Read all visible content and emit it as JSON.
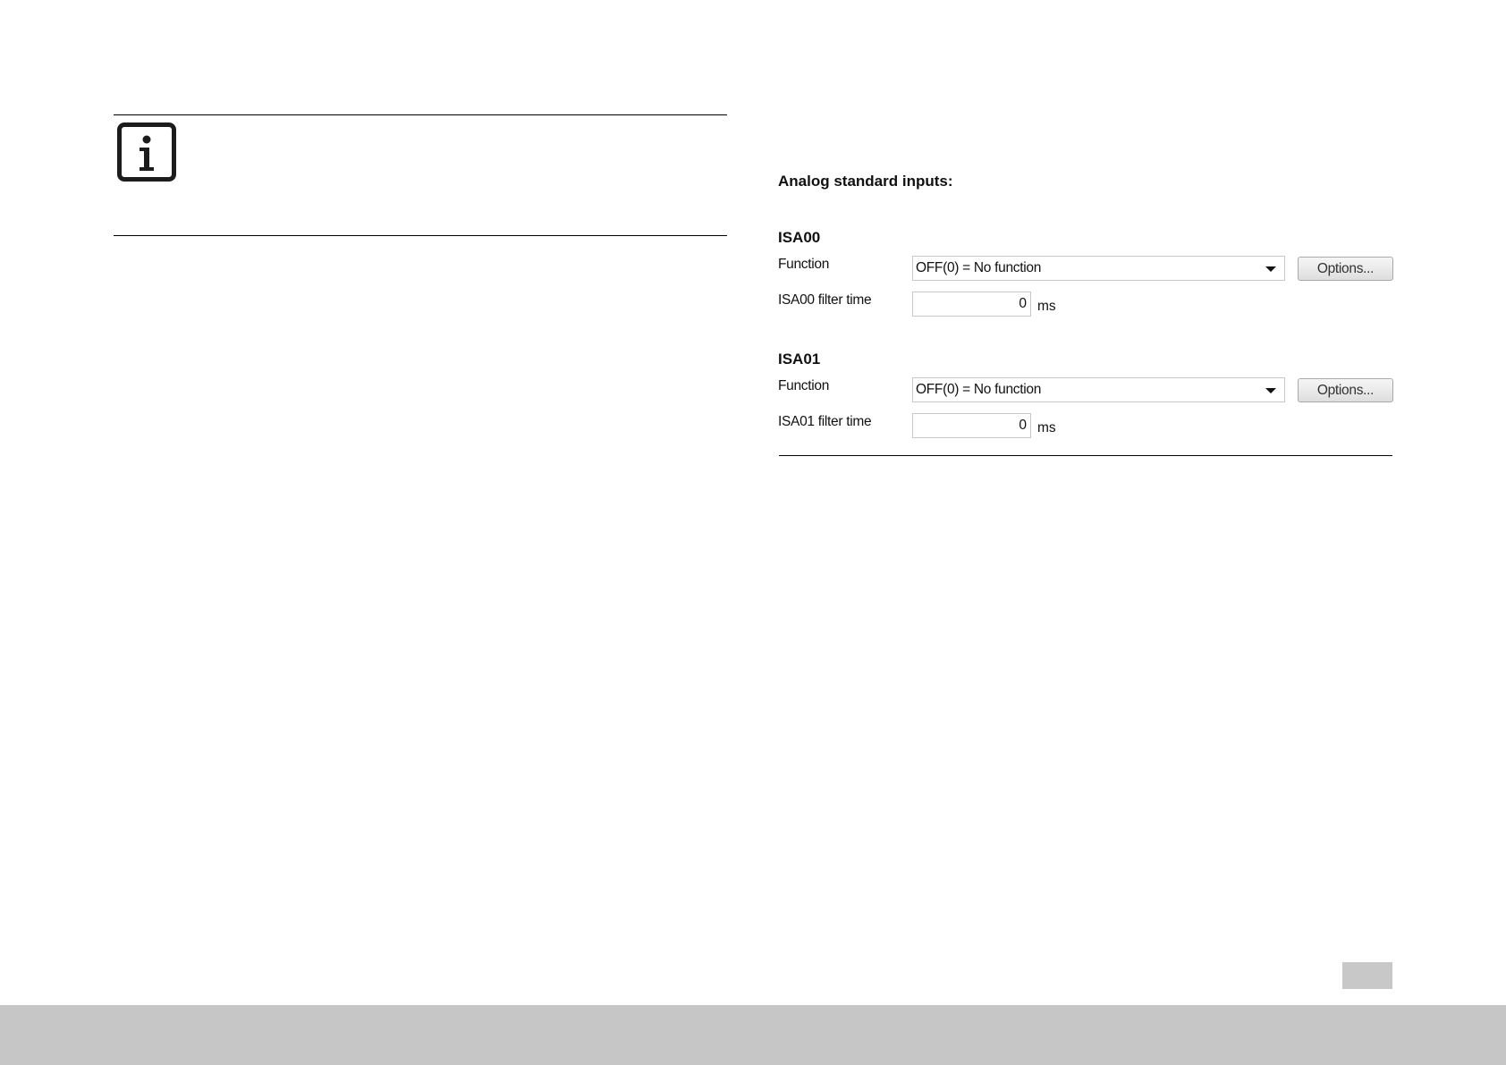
{
  "note": {
    "icon": "info-icon"
  },
  "panel": {
    "heading": "Analog standard inputs:",
    "groups": [
      {
        "title": "ISA00",
        "function_label": "Function",
        "function_value": "OFF(0) = No function",
        "options_label": "Options...",
        "filter_label": "ISA00 filter time",
        "filter_value": "0",
        "filter_unit": "ms"
      },
      {
        "title": "ISA01",
        "function_label": "Function",
        "function_value": "OFF(0) = No function",
        "options_label": "Options...",
        "filter_label": "ISA01 filter time",
        "filter_value": "0",
        "filter_unit": "ms"
      }
    ]
  },
  "colors": {
    "footer": "#c6c6c6",
    "page_tab": "#c8c8c8"
  }
}
